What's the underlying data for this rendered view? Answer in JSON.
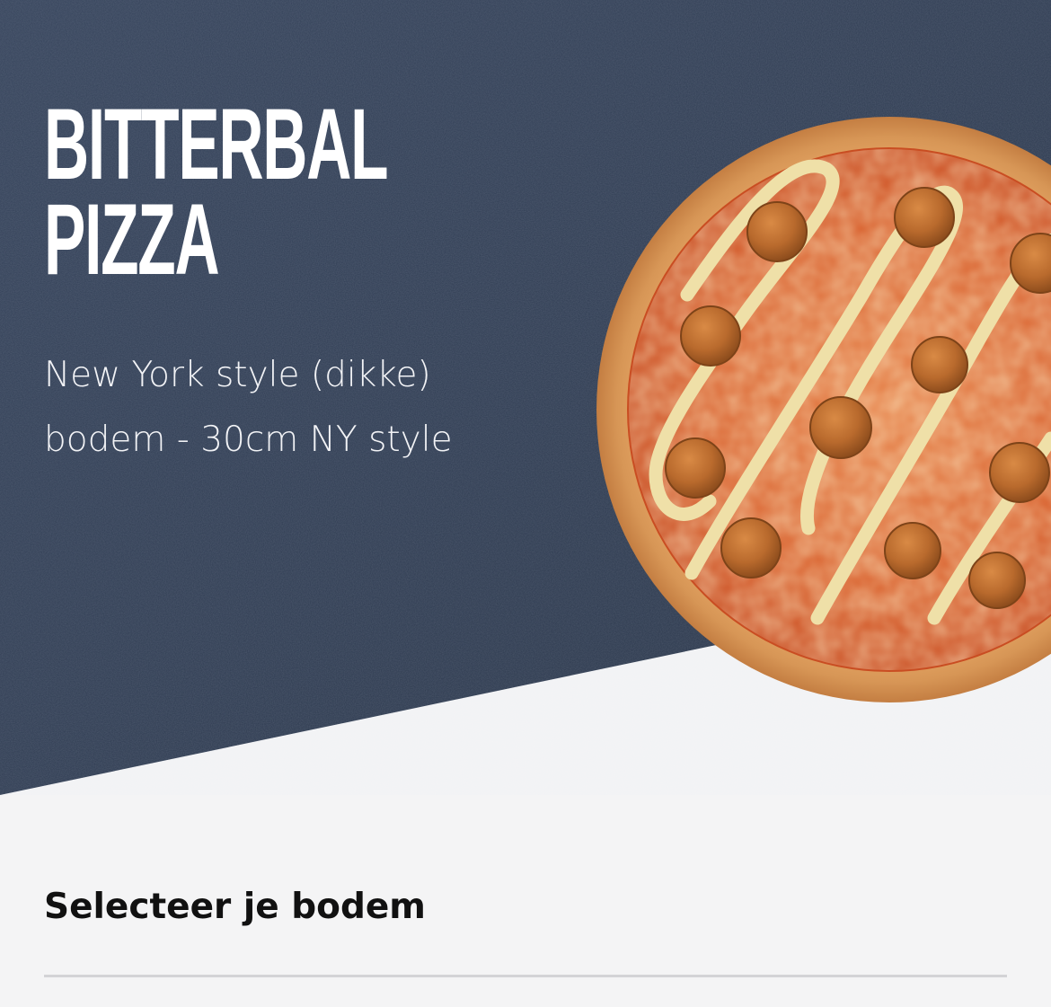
{
  "product": {
    "title_line1": "BITTERBAL",
    "title_line2": "PIZZA",
    "description": "New York style (dikke) bodem - 30cm NY style",
    "image": "bitterbal-pizza-image"
  },
  "crust_section": {
    "title": "Selecteer je bodem"
  },
  "colors": {
    "hero_background": "#2f3c50",
    "page_background": "#f4f4f5",
    "title_text": "#ffffff",
    "section_text": "#111111"
  }
}
